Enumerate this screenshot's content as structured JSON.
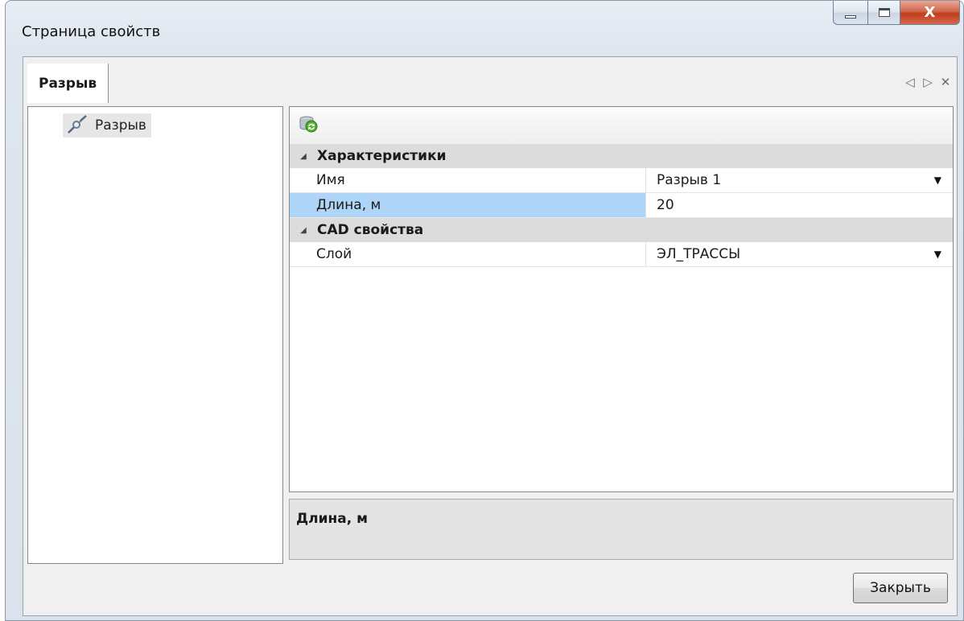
{
  "window": {
    "title": "Страница свойств",
    "close_glyph": "X"
  },
  "tabs": [
    {
      "label": "Разрыв"
    }
  ],
  "tab_controls": {
    "prev": "◁",
    "next": "▷",
    "close": "✕"
  },
  "tree": {
    "items": [
      {
        "label": "Разрыв",
        "icon": "break-line-icon"
      }
    ]
  },
  "property_grid": {
    "toolbar_icon": "refresh-database-icon",
    "categories": [
      {
        "name": "Характеристики",
        "properties": [
          {
            "name": "Имя",
            "value": "Разрыв 1",
            "has_dropdown": true
          },
          {
            "name": "Длина, м",
            "value": "20",
            "has_dropdown": false,
            "selected": true
          }
        ]
      },
      {
        "name": "CAD свойства",
        "properties": [
          {
            "name": "Слой",
            "value": "ЭЛ_ТРАССЫ",
            "has_dropdown": true
          }
        ]
      }
    ]
  },
  "description": {
    "title": "Длина, м"
  },
  "buttons": {
    "close_label": "Закрыть"
  },
  "colors": {
    "selection": "#aed5f8",
    "category_bg": "#dcdcdc",
    "close_red": "#c23c1c"
  }
}
